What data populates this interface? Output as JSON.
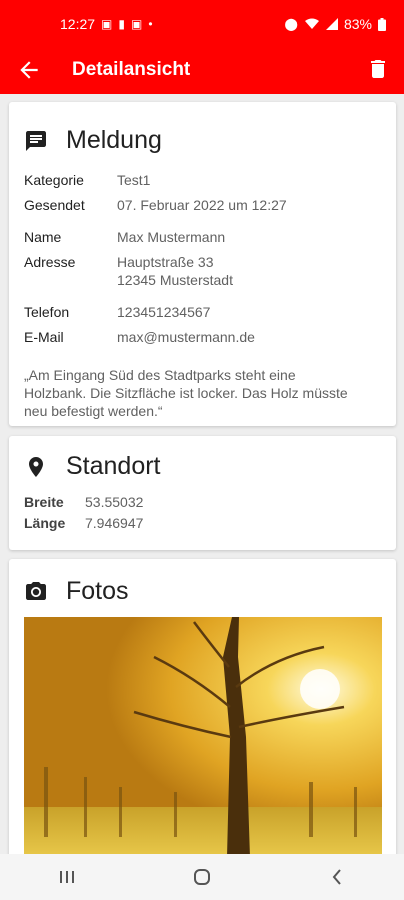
{
  "status_bar": {
    "time": "12:27",
    "battery": "83%"
  },
  "app_bar": {
    "title": "Detailansicht"
  },
  "report": {
    "heading": "Meldung",
    "category_label": "Kategorie",
    "category_value": "Test1",
    "sent_label": "Gesendet",
    "sent_value": "07. Februar 2022 um 12:27",
    "name_label": "Name",
    "name_value": "Max Mustermann",
    "address_label": "Adresse",
    "address_line1": "Hauptstraße 33",
    "address_line2": "12345 Musterstadt",
    "phone_label": "Telefon",
    "phone_value": "123451234567",
    "email_label": "E-Mail",
    "email_value": "max@mustermann.de",
    "message": "„Am Eingang Süd des Stadtparks steht eine Holzbank. Die Sitzfläche ist locker. Das Holz müsste neu befestigt werden.“"
  },
  "location": {
    "heading": "Standort",
    "lat_label": "Breite",
    "lat_value": "53.55032",
    "lon_label": "Länge",
    "lon_value": "7.946947"
  },
  "photos": {
    "heading": "Fotos"
  },
  "colors": {
    "accent": "#ff0000"
  }
}
